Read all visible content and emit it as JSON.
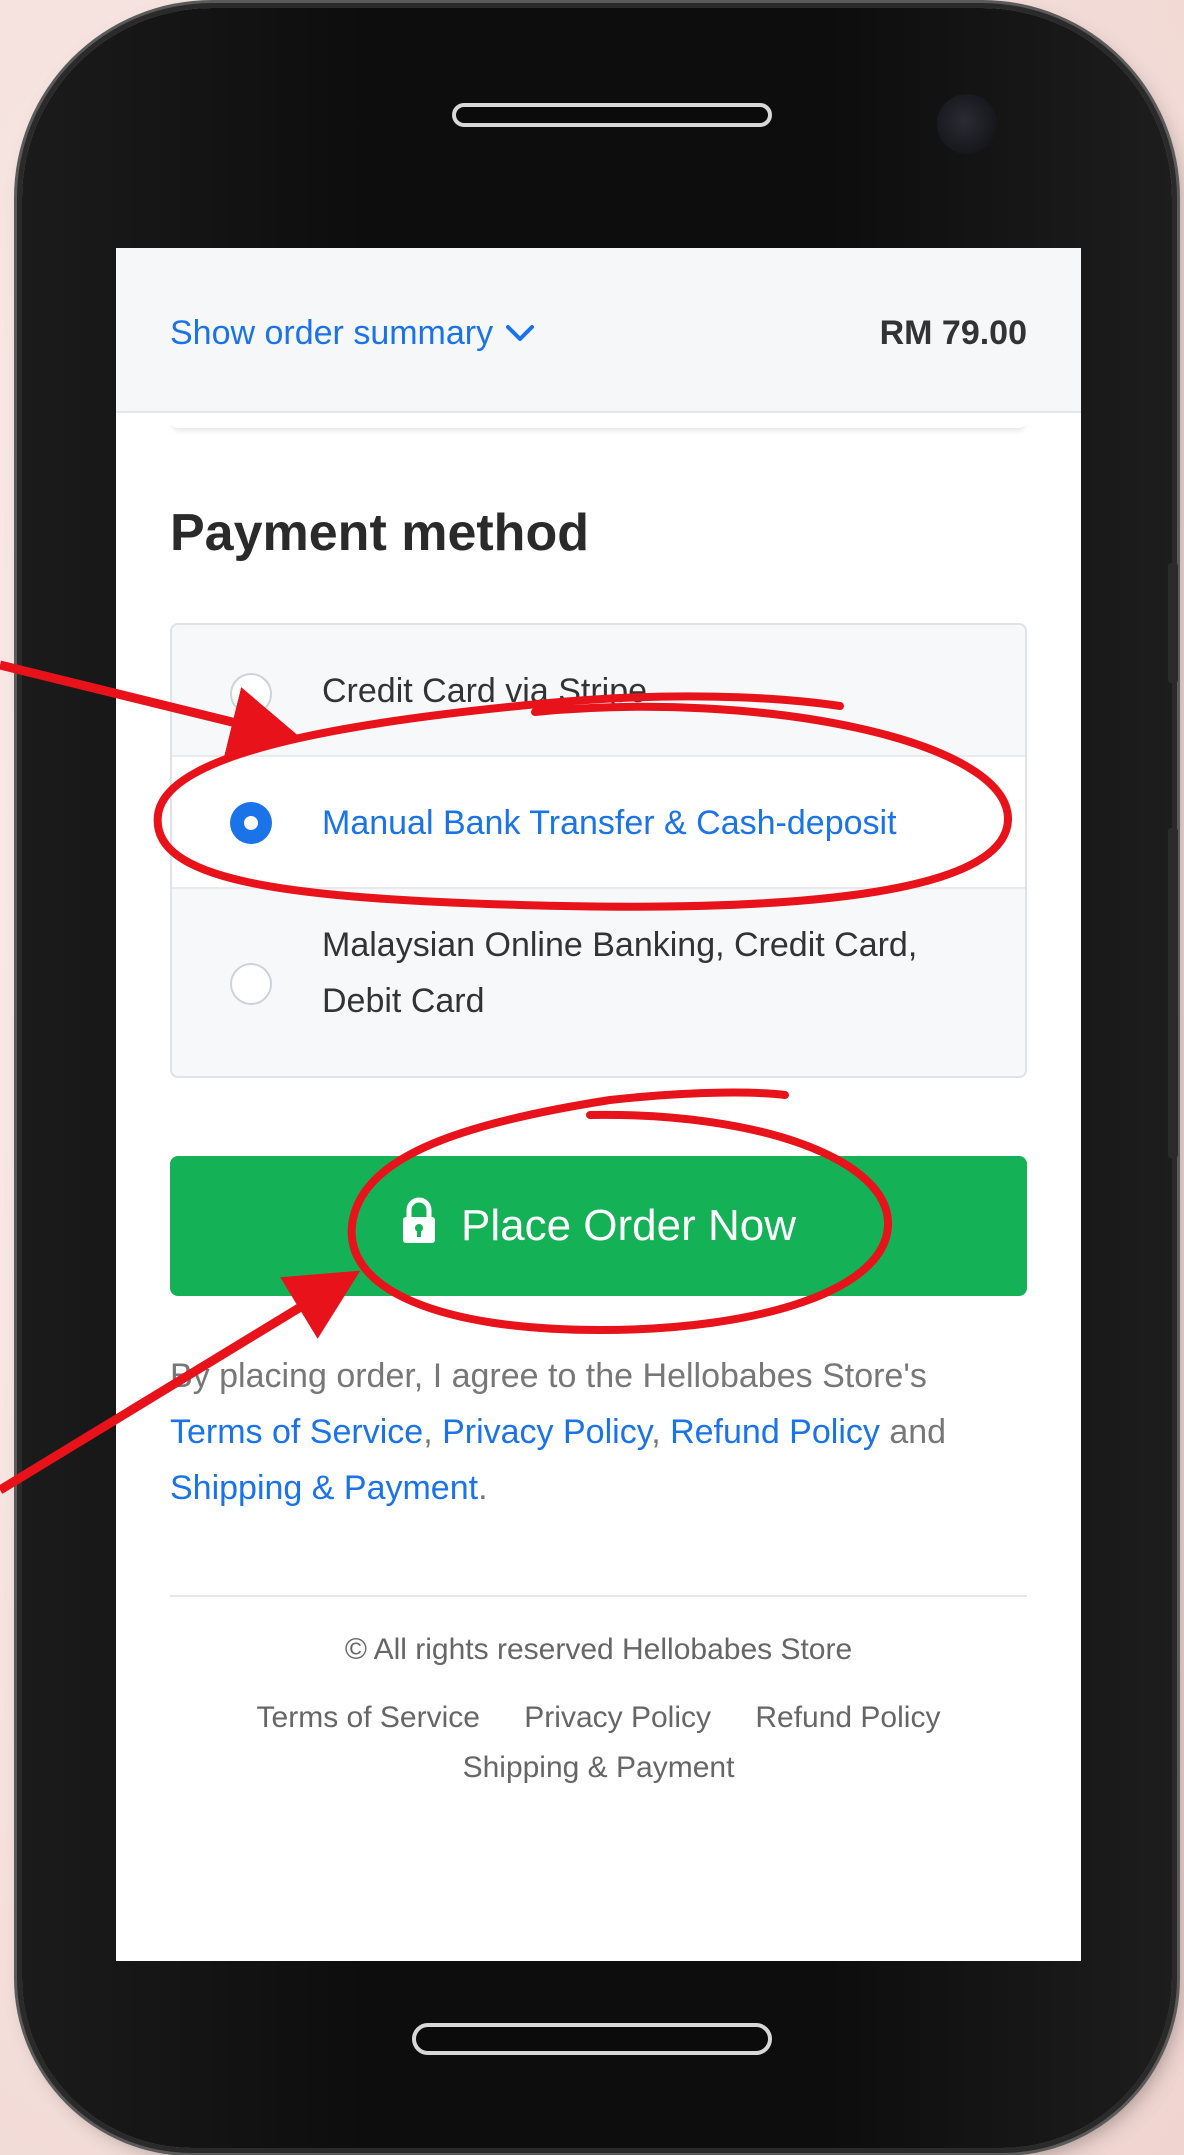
{
  "header": {
    "summary_toggle_label": "Show order summary",
    "order_total": "RM 79.00"
  },
  "payment": {
    "heading": "Payment method",
    "options": [
      {
        "label": "Credit Card via Stripe",
        "selected": false
      },
      {
        "label": "Manual Bank Transfer & Cash-deposit",
        "selected": true
      },
      {
        "label": "Malaysian Online Banking, Credit Card, Debit Card",
        "selected": false
      }
    ]
  },
  "place_order": {
    "label": "Place Order Now",
    "icon": "lock-icon"
  },
  "agreement": {
    "prefix": "By placing order, I agree to the Hellobabes Store's",
    "terms": "Terms of Service",
    "sep1": ", ",
    "privacy": "Privacy Policy",
    "sep2": ", ",
    "refund": "Refund Policy",
    "and": " and ",
    "shipping": "Shipping & Payment",
    "end": "."
  },
  "footer": {
    "copyright": "© All rights reserved Hellobabes Store",
    "links": [
      "Terms of Service",
      "Privacy Policy",
      "Refund Policy",
      "Shipping & Payment"
    ]
  },
  "colors": {
    "accent": "#1a73e8",
    "button_green": "#15b157",
    "annotation_red": "#e8121b"
  }
}
